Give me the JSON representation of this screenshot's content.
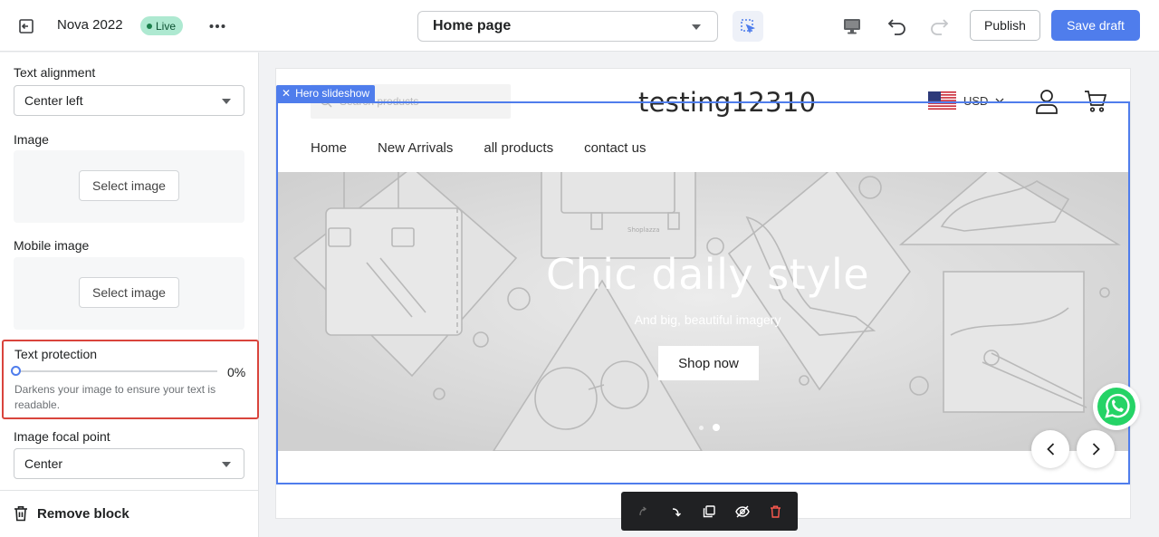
{
  "topbar": {
    "theme_name": "Nova 2022",
    "live_label": "Live",
    "page_selector": "Home page",
    "publish_label": "Publish",
    "save_label": "Save draft"
  },
  "left_panel": {
    "text_alignment": {
      "label": "Text alignment",
      "value": "Center left"
    },
    "image": {
      "label": "Image",
      "button": "Select image"
    },
    "mobile_image": {
      "label": "Mobile image",
      "button": "Select image"
    },
    "text_protection": {
      "label": "Text protection",
      "value": 0,
      "value_display": "0%",
      "help": "Darkens your image to ensure your text is readable."
    },
    "focal_point": {
      "label": "Image focal point",
      "value": "Center"
    },
    "remove_block": "Remove block"
  },
  "preview": {
    "section_tag": "Hero slideshow",
    "search_placeholder": "Search products",
    "store_title": "testing12310",
    "currency": "USD",
    "nav": [
      "Home",
      "New Arrivals",
      "all products",
      "contact us"
    ],
    "hero": {
      "title": "Chic daily style",
      "subtitle": "And big, beautiful imagery",
      "button": "Shop now",
      "art_label": "Shoplazza",
      "slide_count": 2,
      "active_slide": 2
    }
  },
  "colors": {
    "accent": "#4f7dec",
    "live_badge": "#aee9d1",
    "highlight": "#d9443c",
    "whatsapp": "#25d366",
    "delete": "#ff5a4f"
  }
}
